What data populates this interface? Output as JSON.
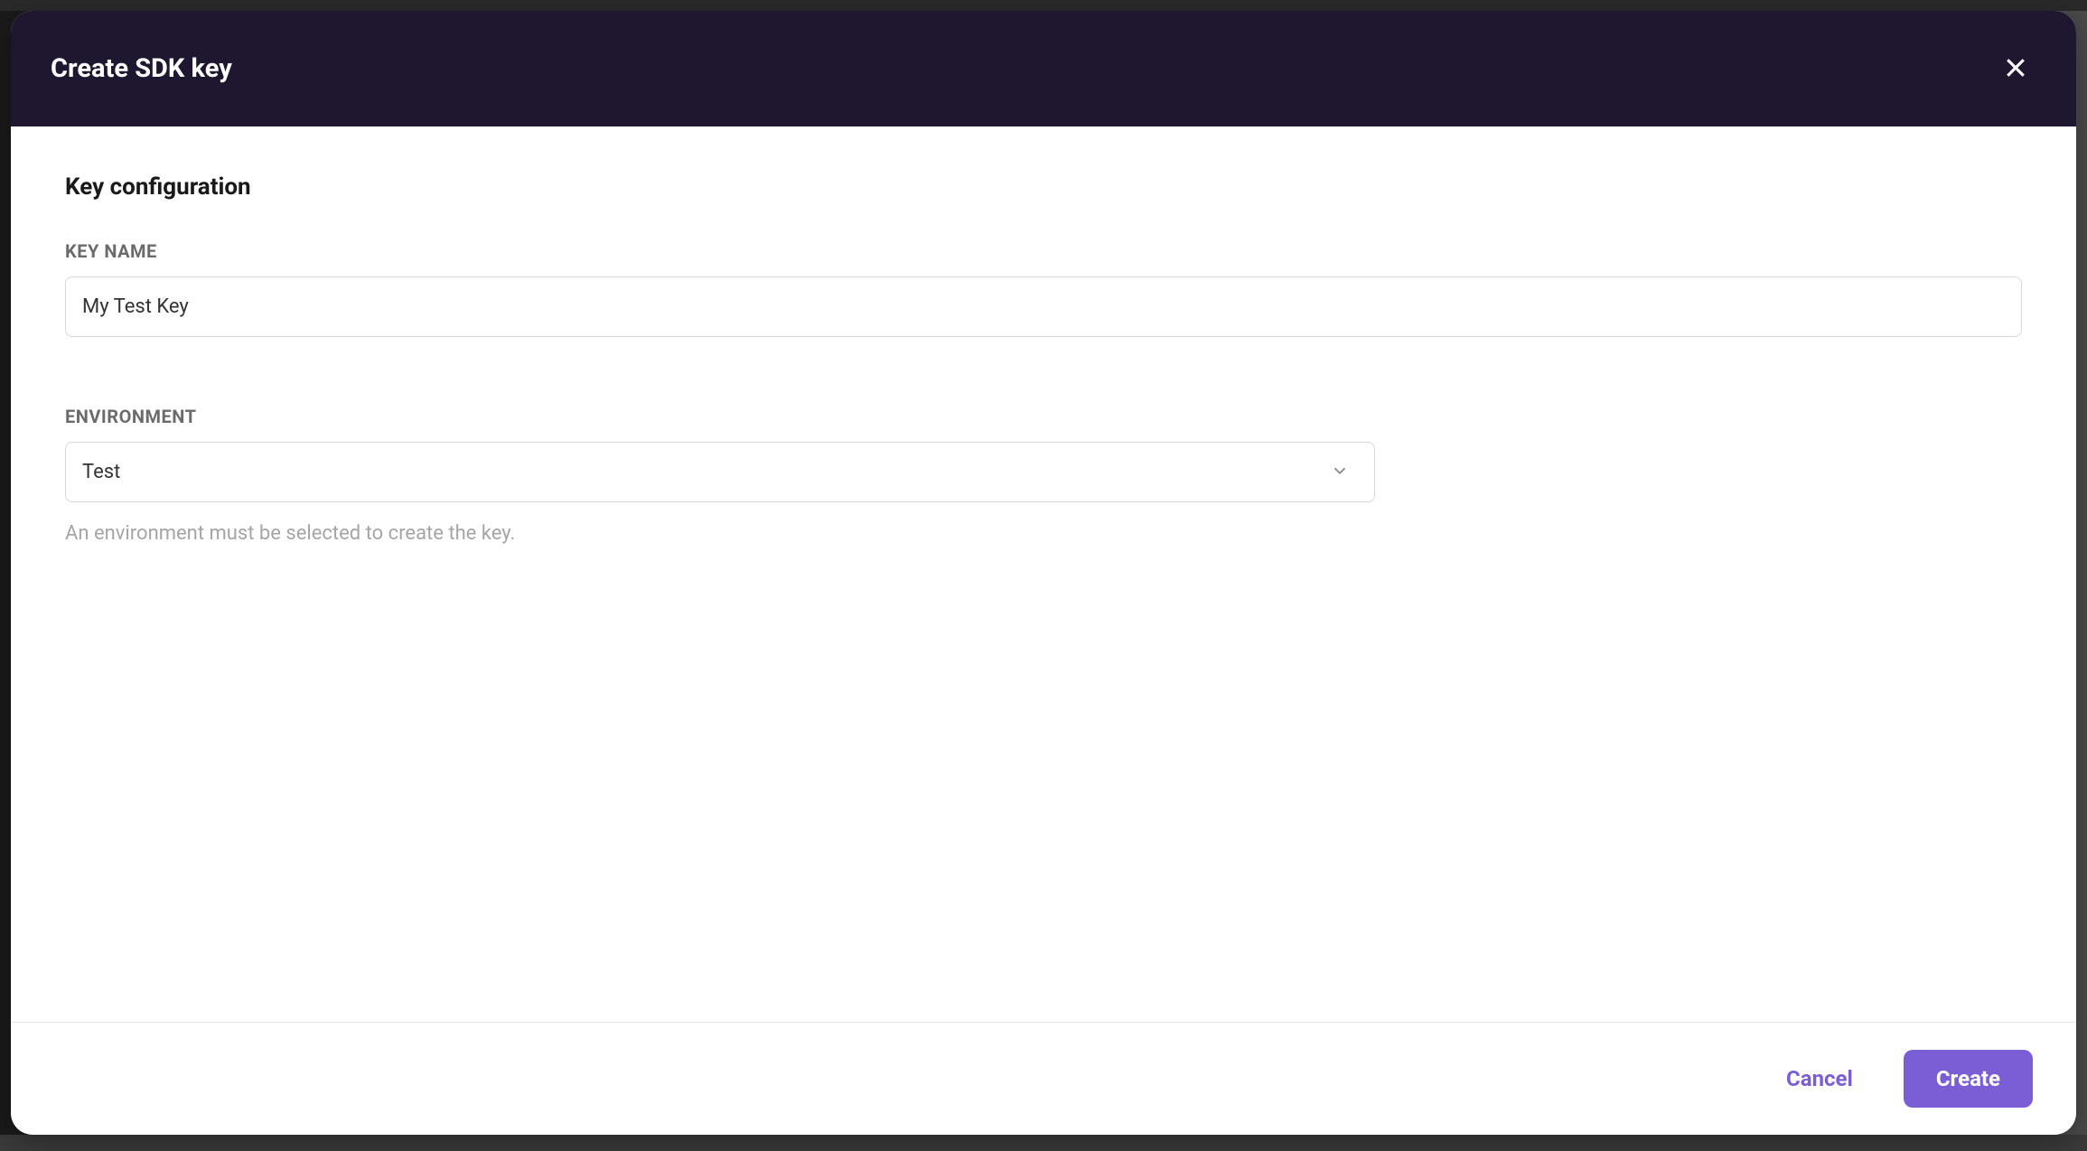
{
  "modal": {
    "title": "Create SDK key",
    "section_title": "Key configuration",
    "key_name": {
      "label": "KEY NAME",
      "value": "My Test Key"
    },
    "environment": {
      "label": "ENVIRONMENT",
      "selected": "Test",
      "helper_text": "An environment must be selected to create the key."
    },
    "footer": {
      "cancel_label": "Cancel",
      "create_label": "Create"
    }
  }
}
